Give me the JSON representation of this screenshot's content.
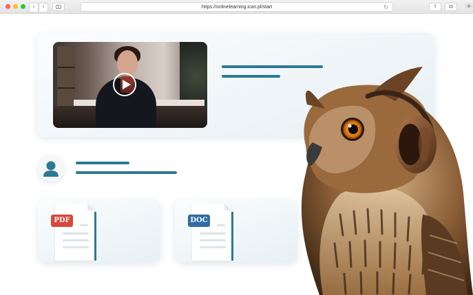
{
  "browser": {
    "url": "https://onlinelearning.ican.pl/start",
    "back_glyph": "‹",
    "forward_glyph": "›",
    "reload_glyph": "↻",
    "share_glyph": "⇪",
    "tabs_glyph": "⧉",
    "newtab_glyph": "+"
  },
  "files": [
    {
      "label": "PDF",
      "color": "#d8473a"
    },
    {
      "label": "DOC",
      "color": "#2f6ca3"
    }
  ],
  "colors": {
    "accent": "#2d7893",
    "card_bg": "#e7f0f4"
  },
  "icons": {
    "play": "play-icon",
    "user": "user-icon",
    "pdf": "pdf-file-icon",
    "doc": "doc-file-icon",
    "mascot": "owl-with-headphones"
  }
}
